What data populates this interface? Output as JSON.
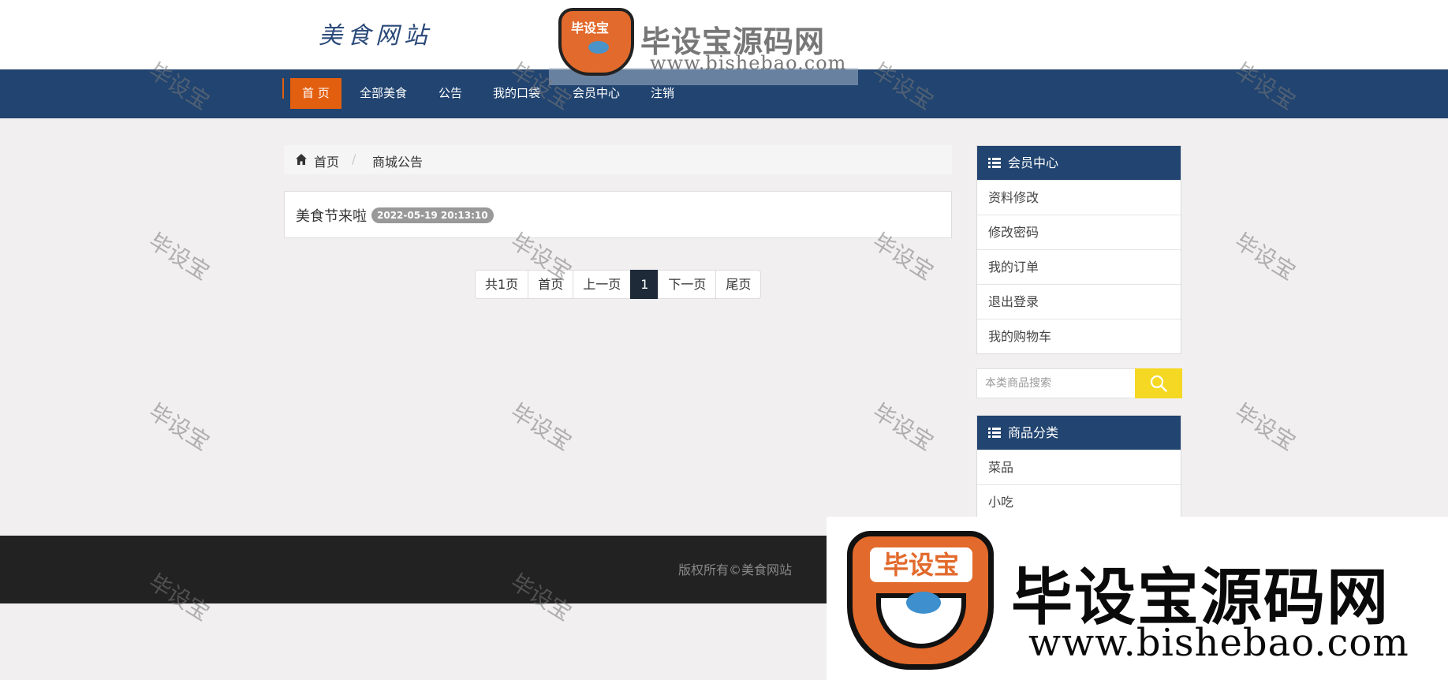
{
  "header": {
    "site_name": "美食网站"
  },
  "watermark": {
    "brand": "毕设宝源码网",
    "badge": "毕设宝",
    "url": "www.bishebao.com",
    "tile_text": "毕设宝"
  },
  "nav": {
    "items": [
      {
        "label": "首 页",
        "active": true
      },
      {
        "label": "全部美食"
      },
      {
        "label": "公告"
      },
      {
        "label": "我的口袋"
      },
      {
        "label": "会员中心"
      },
      {
        "label": "注销"
      }
    ]
  },
  "breadcrumb": {
    "home": "首页",
    "separator": "/",
    "current": "商城公告"
  },
  "notices": [
    {
      "title": "美食节来啦",
      "date": "2022-05-19 20:13:10"
    }
  ],
  "pagination": {
    "total": "共1页",
    "first": "首页",
    "prev": "上一页",
    "current": "1",
    "next": "下一页",
    "last": "尾页"
  },
  "member_panel": {
    "title": "会员中心",
    "items": [
      "资料修改",
      "修改密码",
      "我的订单",
      "退出登录",
      "我的购物车"
    ]
  },
  "search": {
    "placeholder": "本类商品搜索"
  },
  "category_panel": {
    "title": "商品分类",
    "items": [
      "菜品",
      "小吃"
    ]
  },
  "footer": {
    "copyright": "版权所有©美食网站"
  },
  "colors": {
    "nav_bg": "#214470",
    "accent": "#e35f10",
    "search_button": "#f5d823",
    "footer_bg": "#222222",
    "page_bg": "#f1eff0"
  }
}
